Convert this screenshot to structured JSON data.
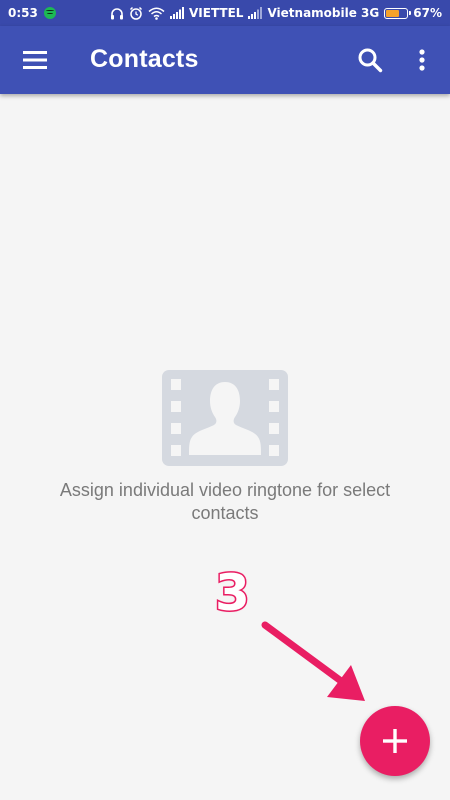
{
  "status_bar": {
    "time": "0:53",
    "carrier_1": "VIETTEL",
    "carrier_2": "Vietnamobile 3G",
    "battery_percent": "67%",
    "battery_level": 0.67,
    "icons": [
      "spotify-icon",
      "headphones-icon",
      "alarm-icon",
      "wifi-icon",
      "signal-icon",
      "signal-icon",
      "battery-icon"
    ]
  },
  "app_bar": {
    "title": "Contacts",
    "menu_icon": "hamburger-menu-icon",
    "search_icon": "search-icon",
    "more_icon": "more-vert-icon"
  },
  "empty_state": {
    "icon": "video-contact-icon",
    "message": "Assign individual video ringtone for select contacts"
  },
  "annotation": {
    "number": "3",
    "arrow_icon": "arrow-icon"
  },
  "fab": {
    "icon": "plus-icon"
  },
  "colors": {
    "status_bar": "#3949ab",
    "app_bar": "#3f51b5",
    "background": "#f5f5f5",
    "fab": "#e91e63",
    "annotation": "#e91e63",
    "empty_icon": "#d5d9e0",
    "empty_text": "#7a7a7a"
  }
}
